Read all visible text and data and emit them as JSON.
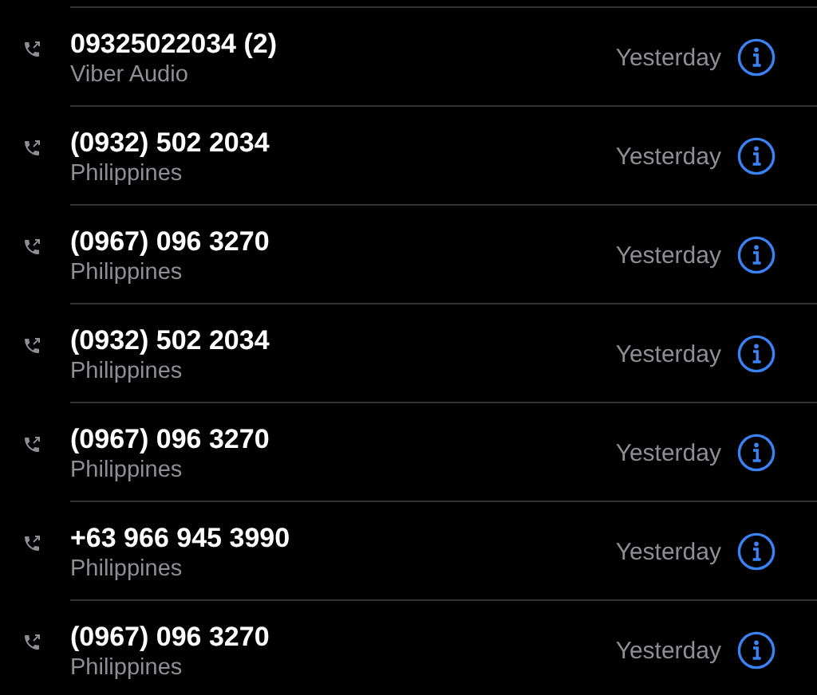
{
  "calls": [
    {
      "number": "09325022034 (2)",
      "label": "Viber Audio",
      "time": "Yesterday"
    },
    {
      "number": "(0932) 502 2034",
      "label": "Philippines",
      "time": "Yesterday"
    },
    {
      "number": "(0967) 096 3270",
      "label": "Philippines",
      "time": "Yesterday"
    },
    {
      "number": "(0932) 502 2034",
      "label": "Philippines",
      "time": "Yesterday"
    },
    {
      "number": "(0967) 096 3270",
      "label": "Philippines",
      "time": "Yesterday"
    },
    {
      "number": "+63 966 945 3990",
      "label": "Philippines",
      "time": "Yesterday"
    },
    {
      "number": "(0967) 096 3270",
      "label": "Philippines",
      "time": "Yesterday"
    }
  ]
}
